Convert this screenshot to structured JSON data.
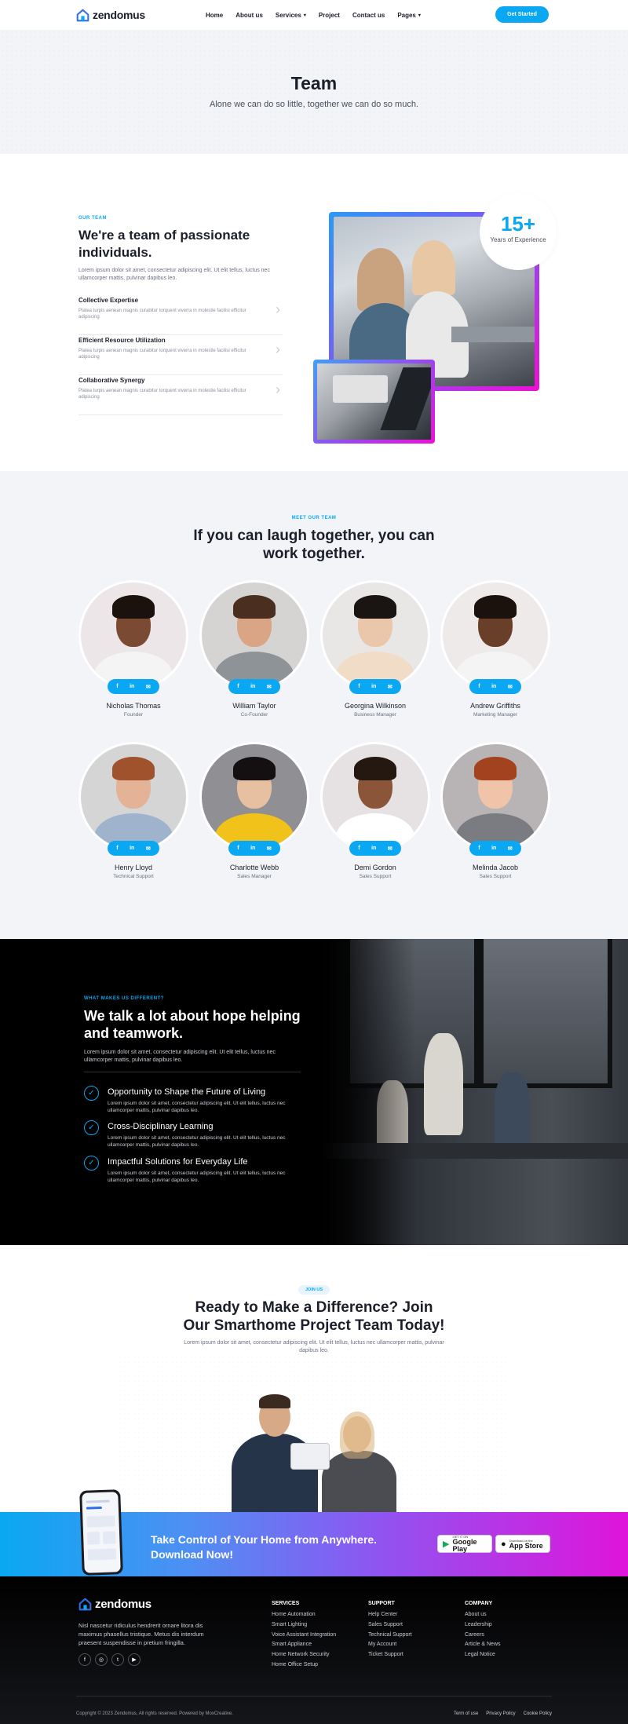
{
  "brand": {
    "name": "zendomus"
  },
  "nav": {
    "items": [
      {
        "label": "Home",
        "caret": false
      },
      {
        "label": "About us",
        "caret": false
      },
      {
        "label": "Services",
        "caret": true
      },
      {
        "label": "Project",
        "caret": false
      },
      {
        "label": "Contact us",
        "caret": false
      },
      {
        "label": "Pages",
        "caret": true
      }
    ],
    "cta": "Get Started"
  },
  "hero": {
    "title": "Team",
    "subtitle": "Alone we can do so little, together we can do so much."
  },
  "about": {
    "eyebrow": "OUR TEAM",
    "title": "We're a team of passionate individuals.",
    "lead": "Lorem ipsum dolor sit amet, consectetur adipiscing elit. Ut elit tellus, luctus nec ullamcorper mattis, pulvinar dapibus leo.",
    "features": [
      {
        "title": "Collective Expertise",
        "text": "Platea turpis aenean magnis curabitur torquent viverra in molestie facilisi efficitur adipiscing"
      },
      {
        "title": "Efficient Resource Utilization",
        "text": "Platea turpis aenean magnis curabitur torquent viverra in molestie facilisi efficitur adipiscing"
      },
      {
        "title": "Collaborative Synergy",
        "text": "Platea turpis aenean magnis curabitur torquent viverra in molestie facilisi efficitur adipiscing"
      }
    ],
    "experience": {
      "number": "15+",
      "caption": "Years of Experience"
    }
  },
  "team": {
    "eyebrow": "MEET OUR TEAM",
    "title": "If you can laugh together, you can work together.",
    "members": [
      {
        "name": "Nicholas Thomas",
        "role": "Founder"
      },
      {
        "name": "William Taylor",
        "role": "Co-Founder"
      },
      {
        "name": "Georgina Wilkinson",
        "role": "Business Manager"
      },
      {
        "name": "Andrew Griffiths",
        "role": "Marketing Manager"
      },
      {
        "name": "Henry Lloyd",
        "role": "Technical Support"
      },
      {
        "name": "Charlotte Webb",
        "role": "Sales Manager"
      },
      {
        "name": "Demi Gordon",
        "role": "Sales Support"
      },
      {
        "name": "Melinda Jacob",
        "role": "Sales Support"
      }
    ],
    "social_icons": [
      "f",
      "in",
      "✉"
    ]
  },
  "why": {
    "eyebrow": "WHAT MAKES US DIFFERENT?",
    "title": "We talk a lot about hope helping and teamwork.",
    "lead": "Lorem ipsum dolor sit amet, consectetur adipiscing elit. Ut elit tellus, luctus nec ullamcorper mattis, pulvinar dapibus leo.",
    "points": [
      {
        "title": "Opportunity to Shape the Future of Living",
        "text": "Lorem ipsum dolor sit amet, consectetur adipiscing elit. Ut elit tellus, luctus nec ullamcorper mattis, pulvinar dapibus leo."
      },
      {
        "title": "Cross-Disciplinary Learning",
        "text": "Lorem ipsum dolor sit amet, consectetur adipiscing elit. Ut elit tellus, luctus nec ullamcorper mattis, pulvinar dapibus leo."
      },
      {
        "title": "Impactful Solutions for Everyday Life",
        "text": "Lorem ipsum dolor sit amet, consectetur adipiscing elit. Ut elit tellus, luctus nec ullamcorper mattis, pulvinar dapibus leo."
      }
    ]
  },
  "join": {
    "eyebrow": "JOIN US",
    "title": "Ready to Make a Difference? Join Our Smarthome Project Team Today!",
    "lead": "Lorem ipsum dolor sit amet, consectetur adipiscing elit. Ut elit tellus, luctus nec ullamcorper mattis, pulvinar dapibus leo."
  },
  "cta": {
    "title": "Take Control of Your Home from Anywhere. Download Now!",
    "google": {
      "small": "GET IT ON",
      "big": "Google Play"
    },
    "apple": {
      "small": "Download on the",
      "big": "App Store"
    }
  },
  "footer": {
    "description": "Nisl nascetur ridiculus hendrerit ornare litora dis maximus phasellus tristique. Metus dis interdum praesent suspendisse in pretium fringilla.",
    "columns": [
      {
        "title": "SERVICES",
        "links": [
          "Home Automation",
          "Smart Lighting",
          "Voice Assistant Integration",
          "Smart Appliance",
          "Home Network Security",
          "Home Office Setup"
        ]
      },
      {
        "title": "SUPPORT",
        "links": [
          "Help Center",
          "Sales Support",
          "Technical Support",
          "My Account",
          "Ticket Support"
        ]
      },
      {
        "title": "COMPANY",
        "links": [
          "About us",
          "Leadership",
          "Careers",
          "Article & News",
          "Legal Notice"
        ]
      }
    ],
    "copyright": "Copyright © 2023 Zendomus, All rights reserved. Powered by MoxCreative.",
    "legal_links": [
      "Term of use",
      "Privacy Policy",
      "Cookie Policy"
    ]
  },
  "colors": {
    "accent": "#0aa8f2",
    "dark": "#1c1f2a",
    "magenta": "#e014da"
  }
}
